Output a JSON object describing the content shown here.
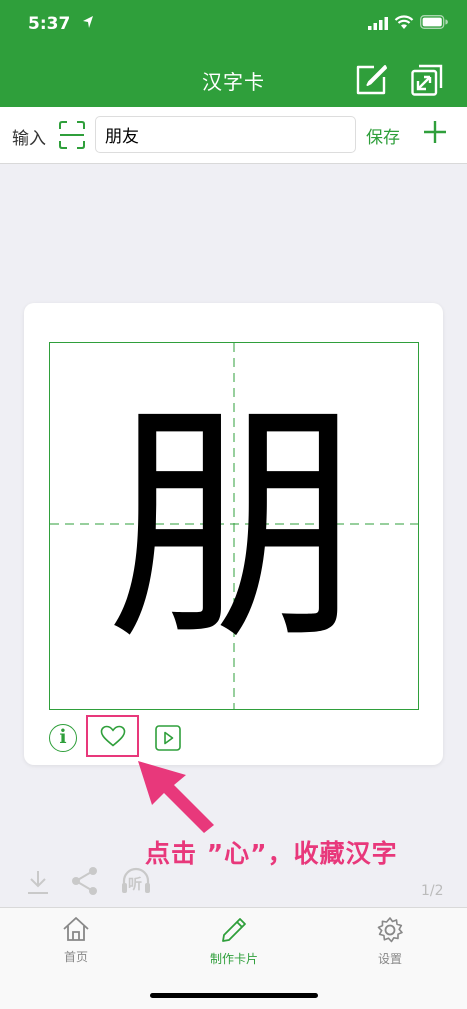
{
  "status": {
    "time": "5:37"
  },
  "header": {
    "title": "汉字卡"
  },
  "input_bar": {
    "label": "输入",
    "value": "朋友",
    "save_label": "保存"
  },
  "card": {
    "character": "朋"
  },
  "annotation": {
    "text": "点击 ”心”，收藏汉字"
  },
  "tools": {
    "pager": "1/2",
    "listen_glyph": "听"
  },
  "tabs": [
    {
      "label": "首页",
      "icon": "home-icon"
    },
    {
      "label": "制作卡片",
      "icon": "pencil-icon"
    },
    {
      "label": "设置",
      "icon": "gear-icon"
    }
  ],
  "colors": {
    "brand": "#2f9f3b",
    "highlight": "#e8387b"
  }
}
